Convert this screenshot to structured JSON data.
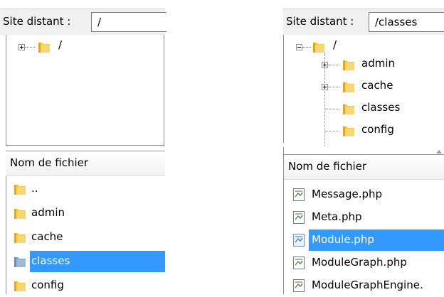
{
  "left": {
    "remote_site_label": "Site distant :",
    "remote_path": "/",
    "tree": [
      {
        "label": "/",
        "expander": "plus"
      }
    ],
    "list_header": "Nom de fichier",
    "files": [
      {
        "name": "..",
        "type": "folder",
        "selected": false
      },
      {
        "name": "admin",
        "type": "folder",
        "selected": false
      },
      {
        "name": "cache",
        "type": "folder",
        "selected": false
      },
      {
        "name": "classes",
        "type": "folder",
        "selected": true
      },
      {
        "name": "config",
        "type": "folder",
        "selected": false
      }
    ]
  },
  "right": {
    "remote_site_label": "Site distant :",
    "remote_path": "/classes",
    "tree": [
      {
        "label": "/",
        "expander": "minus"
      },
      {
        "label": "admin",
        "expander": "plus"
      },
      {
        "label": "cache",
        "expander": "plus"
      },
      {
        "label": "classes",
        "expander": "none"
      },
      {
        "label": "config",
        "expander": "none"
      }
    ],
    "list_header": "Nom de fichier",
    "files": [
      {
        "name": "Message.php",
        "type": "file",
        "selected": false
      },
      {
        "name": "Meta.php",
        "type": "file",
        "selected": false
      },
      {
        "name": "Module.php",
        "type": "file",
        "selected": true
      },
      {
        "name": "ModuleGraph.php",
        "type": "file",
        "selected": false
      },
      {
        "name": "ModuleGraphEngine.",
        "type": "file",
        "selected": false
      }
    ]
  },
  "colors": {
    "selection": "#3399ff",
    "folder": "#f2c84b",
    "bar_bg": "#f0f0f0"
  },
  "icons": {
    "folder": "folder-icon",
    "file": "php-file-icon",
    "expand": "expand-plus-icon",
    "collapse": "collapse-minus-icon"
  }
}
